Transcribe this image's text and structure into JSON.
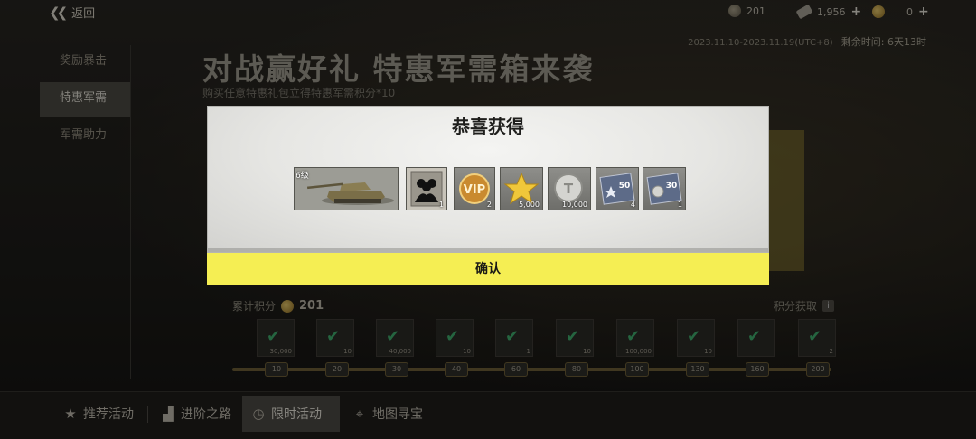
{
  "topbar": {
    "back_label": "返回",
    "currency_1": "201",
    "currency_2": "1,956",
    "currency_3": "0"
  },
  "event": {
    "date_range": "2023.11.10-2023.11.19(UTC+8)",
    "time_left": "剩余时间: 6天13时",
    "title": "对战赢好礼 特惠军需箱来袭",
    "subtitle": "购买任意特惠礼包立得特惠军需积分*10"
  },
  "sidebar": {
    "items": [
      {
        "label": "奖励暴击"
      },
      {
        "label": "特惠军需"
      },
      {
        "label": "军需助力"
      }
    ]
  },
  "progress": {
    "label": "累计积分",
    "total": "201",
    "get_points": "积分获取",
    "reward_amounts": [
      "30,000",
      "10",
      "40,000",
      "10",
      "1",
      "10",
      "100,000",
      "10",
      "",
      "2"
    ],
    "milestones": [
      "10",
      "20",
      "30",
      "40",
      "60",
      "80",
      "100",
      "130",
      "160",
      "200"
    ]
  },
  "modal": {
    "title": "恭喜获得",
    "confirm_label": "确认",
    "items": [
      {
        "icon": "tank-icon",
        "tier": "6级",
        "qty": ""
      },
      {
        "icon": "crew-icon",
        "qty": "1"
      },
      {
        "icon": "vip-icon",
        "qty": "2"
      },
      {
        "icon": "star-icon",
        "qty": "5,000"
      },
      {
        "icon": "silver-coin-icon",
        "qty": "10,000"
      },
      {
        "icon": "xp-boost-50-icon",
        "badge": "50",
        "qty": "4"
      },
      {
        "icon": "credit-boost-30-icon",
        "badge": "30",
        "qty": "1"
      }
    ]
  },
  "bottom_nav": {
    "items": [
      {
        "label": "推荐活动"
      },
      {
        "label": "进阶之路"
      },
      {
        "label": "限时活动"
      },
      {
        "label": "地图寻宝"
      }
    ]
  },
  "colors": {
    "confirm_yellow": "#f5ee53",
    "check_green": "#3fa96b"
  }
}
